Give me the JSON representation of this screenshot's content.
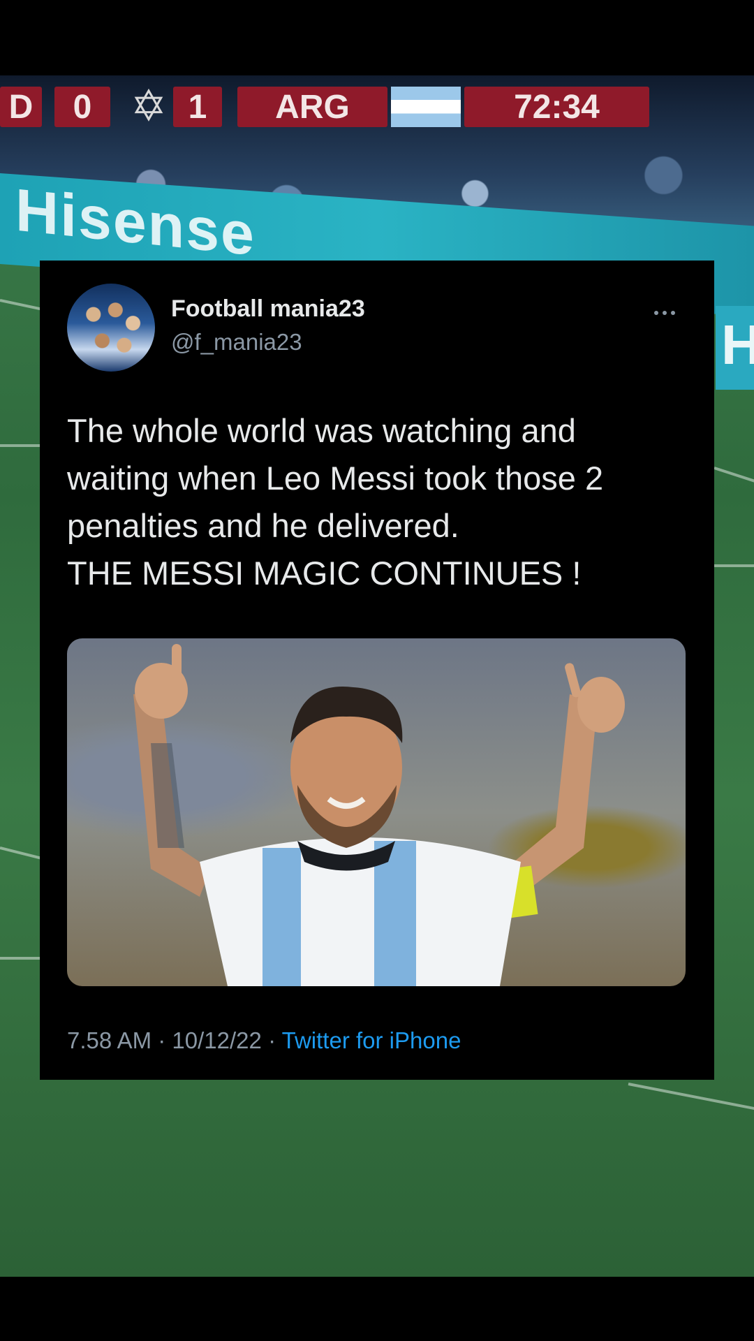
{
  "scoreboard": {
    "home_code": "D",
    "home_score": "0",
    "away_score": "1",
    "away_code": "ARG",
    "match_clock": "72:34"
  },
  "background": {
    "ad_text": "Hisense",
    "side_letter": "H"
  },
  "tweet": {
    "author_name": "Football mania23",
    "author_handle": "@f_mania23",
    "text_lines": [
      "The whole world was watching and",
      "waiting when Leo Messi took those 2",
      "penalties and he delivered.",
      "THE MESSI MAGIC CONTINUES !"
    ],
    "time": "7.58 AM",
    "date": "10/12/22",
    "separator": "·",
    "source": "Twitter for iPhone",
    "more_icon": "more-horizontal-icon"
  },
  "colors": {
    "card_background": "#000000",
    "primary_text": "#e7e9ea",
    "secondary_text": "#8b98a5",
    "link": "#1d9bf0"
  }
}
